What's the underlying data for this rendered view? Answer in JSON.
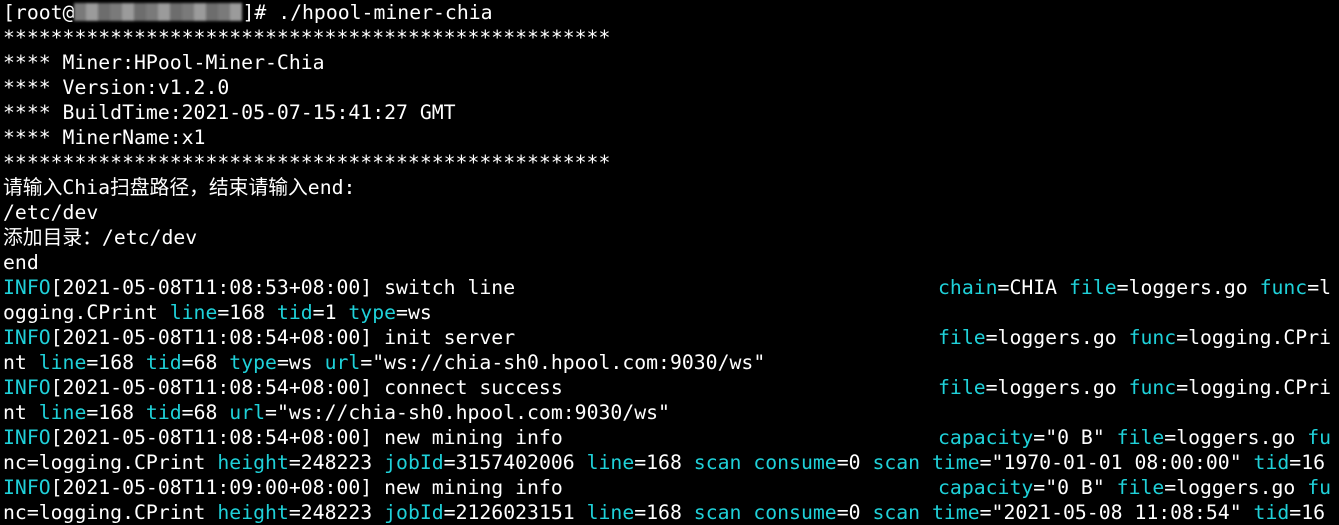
{
  "terminal": {
    "prompt_prefix": "[root@",
    "prompt_suffix": "]# ./hpool-miner-chia",
    "stars": "***************************************************",
    "banner": [
      "**** Miner:HPool-Miner-Chia",
      "**** Version:v1.2.0",
      "**** BuildTime:2021-05-07-15:41:27 GMT",
      "**** MinerName:x1"
    ],
    "input_prompt": "请输入Chia扫盘路径，结束请输入end:",
    "input_value": "/etc/dev",
    "added_dir": "添加目录：/etc/dev",
    "input_end": "end"
  },
  "logs": [
    {
      "level": "INFO",
      "time": "[2021-05-08T11:08:53+08:00]",
      "msg": " switch line",
      "row1_tail": [
        [
          "k",
          "chain"
        ],
        [
          "v",
          "=CHIA "
        ],
        [
          "k",
          "file"
        ],
        [
          "v",
          "=loggers.go "
        ],
        [
          "k",
          "func"
        ],
        [
          "v",
          "=l"
        ]
      ],
      "row2": [
        [
          "v",
          "ogging.CPrint "
        ],
        [
          "k",
          "line"
        ],
        [
          "v",
          "=168 "
        ],
        [
          "k",
          "tid"
        ],
        [
          "v",
          "=1 "
        ],
        [
          "k",
          "type"
        ],
        [
          "v",
          "=ws"
        ]
      ]
    },
    {
      "level": "INFO",
      "time": "[2021-05-08T11:08:54+08:00]",
      "msg": " init server",
      "row1_tail": [
        [
          "k",
          "file"
        ],
        [
          "v",
          "=loggers.go "
        ],
        [
          "k",
          "func"
        ],
        [
          "v",
          "=logging.CPri"
        ]
      ],
      "row2": [
        [
          "v",
          "nt "
        ],
        [
          "k",
          "line"
        ],
        [
          "v",
          "=168 "
        ],
        [
          "k",
          "tid"
        ],
        [
          "v",
          "=68 "
        ],
        [
          "k",
          "type"
        ],
        [
          "v",
          "=ws "
        ],
        [
          "k",
          "url"
        ],
        [
          "v",
          "=\"ws://chia-sh0.hpool.com:9030/ws\""
        ]
      ]
    },
    {
      "level": "INFO",
      "time": "[2021-05-08T11:08:54+08:00]",
      "msg": " connect success",
      "row1_tail": [
        [
          "k",
          "file"
        ],
        [
          "v",
          "=loggers.go "
        ],
        [
          "k",
          "func"
        ],
        [
          "v",
          "=logging.CPri"
        ]
      ],
      "row2": [
        [
          "v",
          "nt "
        ],
        [
          "k",
          "line"
        ],
        [
          "v",
          "=168 "
        ],
        [
          "k",
          "tid"
        ],
        [
          "v",
          "=68 "
        ],
        [
          "k",
          "url"
        ],
        [
          "v",
          "=\"ws://chia-sh0.hpool.com:9030/ws\""
        ]
      ]
    },
    {
      "level": "INFO",
      "time": "[2021-05-08T11:08:54+08:00]",
      "msg": " new mining info",
      "row1_tail": [
        [
          "k",
          "capacity"
        ],
        [
          "v",
          "=\"0 B\" "
        ],
        [
          "k",
          "file"
        ],
        [
          "v",
          "=loggers.go "
        ],
        [
          "k",
          "fu"
        ]
      ],
      "row2": [
        [
          "v",
          "nc=logging.CPrint "
        ],
        [
          "k",
          "height"
        ],
        [
          "v",
          "=248223 "
        ],
        [
          "k",
          "jobId"
        ],
        [
          "v",
          "=3157402006 "
        ],
        [
          "k",
          "line"
        ],
        [
          "v",
          "=168 "
        ],
        [
          "k",
          "scan consume"
        ],
        [
          "v",
          "=0 "
        ],
        [
          "k",
          "scan time"
        ],
        [
          "v",
          "=\"1970-01-01 08:00:00\" "
        ],
        [
          "k",
          "tid"
        ],
        [
          "v",
          "=16"
        ]
      ]
    },
    {
      "level": "INFO",
      "time": "[2021-05-08T11:09:00+08:00]",
      "msg": " new mining info",
      "row1_tail": [
        [
          "k",
          "capacity"
        ],
        [
          "v",
          "=\"0 B\" "
        ],
        [
          "k",
          "file"
        ],
        [
          "v",
          "=loggers.go "
        ],
        [
          "k",
          "fu"
        ]
      ],
      "row2": [
        [
          "v",
          "nc=logging.CPrint "
        ],
        [
          "k",
          "height"
        ],
        [
          "v",
          "=248223 "
        ],
        [
          "k",
          "jobId"
        ],
        [
          "v",
          "=2126023151 "
        ],
        [
          "k",
          "line"
        ],
        [
          "v",
          "=168 "
        ],
        [
          "k",
          "scan consume"
        ],
        [
          "v",
          "=0 "
        ],
        [
          "k",
          "scan time"
        ],
        [
          "v",
          "=\"2021-05-08 11:08:54\" "
        ],
        [
          "k",
          "tid"
        ],
        [
          "v",
          "=16"
        ]
      ]
    }
  ],
  "colors": {
    "background": "#000000",
    "text": "#ffffff",
    "key": "#1fd1d9"
  }
}
